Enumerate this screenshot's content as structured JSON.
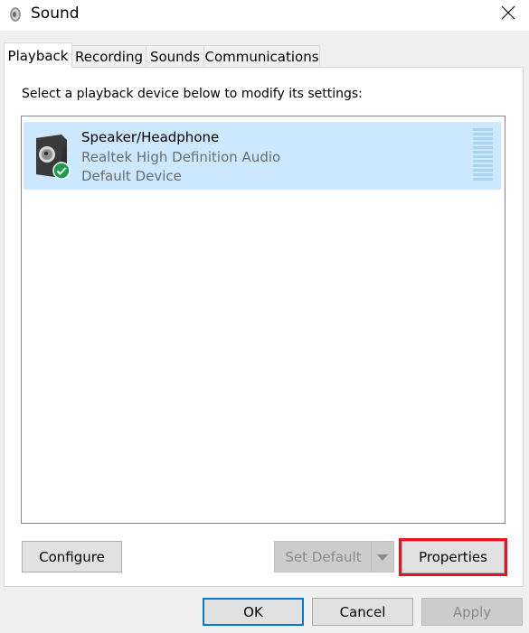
{
  "window": {
    "title": "Sound",
    "close_icon": "close-icon",
    "app_icon": "speaker-icon"
  },
  "tabs": [
    {
      "label": "Playback",
      "active": true
    },
    {
      "label": "Recording",
      "active": false
    },
    {
      "label": "Sounds",
      "active": false
    },
    {
      "label": "Communications",
      "active": false
    }
  ],
  "instruction": "Select a playback device below to modify its settings:",
  "devices": [
    {
      "name": "Speaker/Headphone",
      "driver": "Realtek High Definition Audio",
      "status": "Default Device",
      "icon": "speaker-device-icon",
      "badge": "green-check-icon",
      "selected": true
    }
  ],
  "buttons": {
    "configure": "Configure",
    "set_default": "Set Default",
    "properties": "Properties",
    "ok": "OK",
    "cancel": "Cancel",
    "apply": "Apply"
  },
  "colors": {
    "selection": "#cce8ff",
    "highlight_box": "#e81123",
    "accent": "#0078d7"
  }
}
